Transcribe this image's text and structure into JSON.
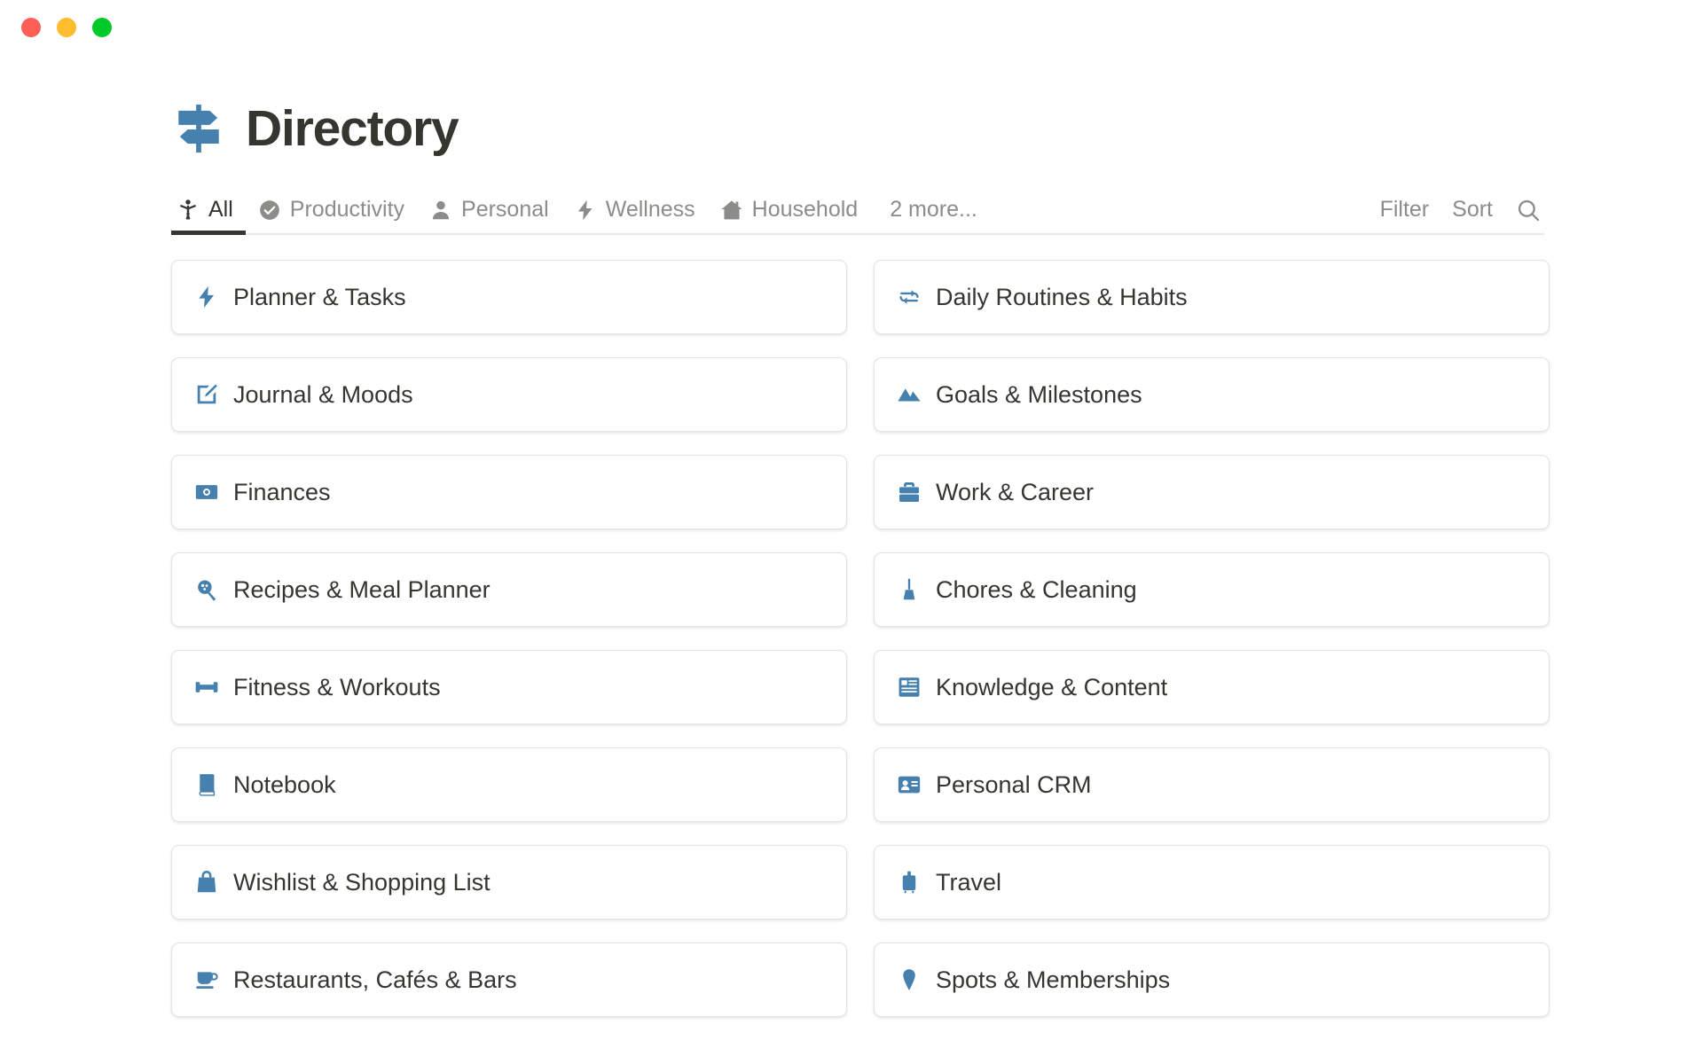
{
  "window": {
    "traffic_lights": [
      {
        "name": "close",
        "color": "#ff5f57"
      },
      {
        "name": "minimize",
        "color": "#ffbd2e"
      },
      {
        "name": "zoom",
        "color": "#00ca28"
      }
    ]
  },
  "header": {
    "icon": "signpost-icon",
    "title": "Directory",
    "icon_color": "#4580ae"
  },
  "tabs": [
    {
      "label": "All",
      "icon": "person-standing-icon",
      "active": true
    },
    {
      "label": "Productivity",
      "icon": "check-circle-icon",
      "active": false
    },
    {
      "label": "Personal",
      "icon": "person-icon",
      "active": false
    },
    {
      "label": "Wellness",
      "icon": "lightning-bolt-icon",
      "active": false
    },
    {
      "label": "Household",
      "icon": "house-icon",
      "active": false
    },
    {
      "label": "2 more...",
      "icon": "",
      "active": false
    }
  ],
  "tab_actions": {
    "filter_label": "Filter",
    "sort_label": "Sort",
    "search_icon": "search-icon"
  },
  "cards": [
    {
      "label": "Planner & Tasks",
      "icon": "lightning-bolt-icon"
    },
    {
      "label": "Daily Routines & Habits",
      "icon": "refresh-arrows-icon"
    },
    {
      "label": "Journal & Moods",
      "icon": "edit-square-icon"
    },
    {
      "label": "Goals & Milestones",
      "icon": "mountains-icon"
    },
    {
      "label": "Finances",
      "icon": "banknote-icon"
    },
    {
      "label": "Work & Career",
      "icon": "briefcase-icon"
    },
    {
      "label": "Recipes & Meal Planner",
      "icon": "pan-icon"
    },
    {
      "label": "Chores & Cleaning",
      "icon": "broom-icon"
    },
    {
      "label": "Fitness & Workouts",
      "icon": "dumbbell-icon"
    },
    {
      "label": "Knowledge & Content",
      "icon": "article-layout-icon"
    },
    {
      "label": "Notebook",
      "icon": "book-icon"
    },
    {
      "label": "Personal CRM",
      "icon": "contact-card-icon"
    },
    {
      "label": "Wishlist & Shopping List",
      "icon": "shopping-bag-icon"
    },
    {
      "label": "Travel",
      "icon": "suitcase-icon"
    },
    {
      "label": "Restaurants, Cafés & Bars",
      "icon": "coffee-cup-icon"
    },
    {
      "label": "Spots & Memberships",
      "icon": "map-pin-icon"
    }
  ],
  "colors": {
    "accent_blue": "#4580ae",
    "text_dark": "#37352f",
    "text_muted": "#8c8c88",
    "card_border": "#e4e4e6",
    "divider": "#eaeaea"
  }
}
